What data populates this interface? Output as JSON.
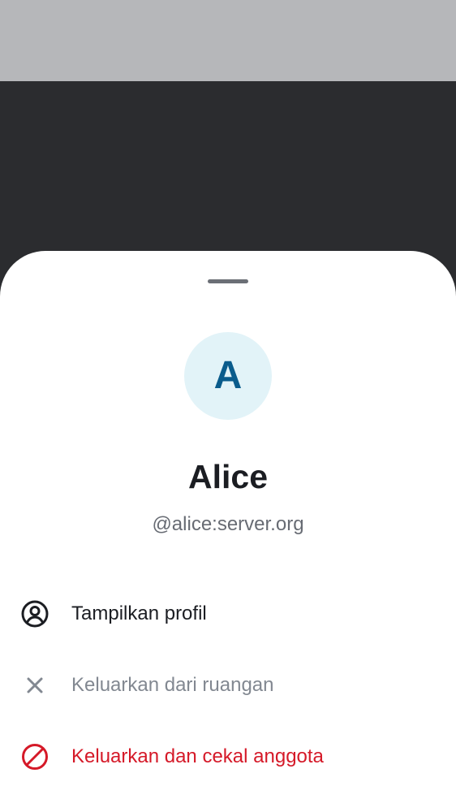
{
  "user": {
    "avatar_initial": "A",
    "display_name": "Alice",
    "user_id": "@alice:server.org"
  },
  "actions": [
    {
      "label": "Tampilkan profil",
      "icon": "user-profile-icon",
      "state": "normal"
    },
    {
      "label": "Keluarkan dari ruangan",
      "icon": "close-icon",
      "state": "disabled"
    },
    {
      "label": "Keluarkan dan cekal anggota",
      "icon": "ban-icon",
      "state": "danger"
    }
  ],
  "colors": {
    "avatar_bg": "#e2f3f8",
    "avatar_text": "#0a5c8c",
    "danger": "#d51928",
    "disabled": "#828891",
    "scrim": "#2b2c2f"
  }
}
